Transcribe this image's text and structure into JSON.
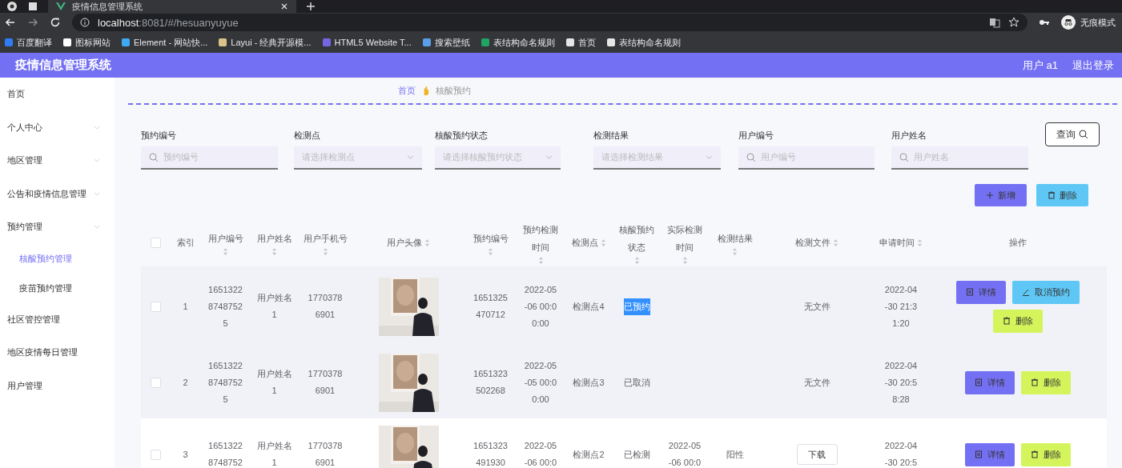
{
  "browser": {
    "tab_title": "疫情信息管理系统",
    "url_host": "localhost",
    "url_rest": ":8081/#/hesuanyuyue",
    "profile": "无痕模式",
    "bookmarks": [
      {
        "label": "百度翻译",
        "color": "#2f7cf6"
      },
      {
        "label": "图标网站",
        "color": "#ffffff"
      },
      {
        "label": "Element - 网站快...",
        "color": "#40a9f5"
      },
      {
        "label": "Layui - 经典开源模...",
        "color": "#d9c48a"
      },
      {
        "label": "HTML5 Website T...",
        "color": "#7466e0"
      },
      {
        "label": "搜索壁纸",
        "color": "#5aa0e8"
      },
      {
        "label": "表结构命名规则",
        "color": "#1fa463"
      },
      {
        "label": "首页",
        "color": "#e6e6e6"
      },
      {
        "label": "表结构命名规则",
        "color": "#e6e6e6"
      }
    ]
  },
  "header": {
    "title": "疫情信息管理系统",
    "user": "用户 a1",
    "logout": "退出登录"
  },
  "sidebar": {
    "items": [
      {
        "label": "首页",
        "expandable": false,
        "selected": false
      },
      {
        "label": "个人中心",
        "expandable": true,
        "selected": false
      },
      {
        "label": "地区管理",
        "expandable": true,
        "selected": false
      },
      {
        "label": "公告和疫情信息管理",
        "expandable": true,
        "selected": false
      },
      {
        "label": "预约管理",
        "expandable": true,
        "selected": false,
        "children": [
          {
            "label": "核酸预约管理",
            "selected": true
          },
          {
            "label": "疫苗预约管理",
            "selected": false
          }
        ]
      },
      {
        "label": "社区管控管理",
        "expandable": false,
        "selected": false
      },
      {
        "label": "地区疫情每日管理",
        "expandable": false,
        "selected": false
      },
      {
        "label": "用户管理",
        "expandable": false,
        "selected": false
      }
    ]
  },
  "breadcrumb": [
    "首页",
    "核酸预约"
  ],
  "filters": [
    {
      "label": "预约编号",
      "kind": "search",
      "placeholder": "预约编号"
    },
    {
      "label": "检测点",
      "kind": "select",
      "placeholder": "请选择检测点"
    },
    {
      "label": "核酸预约状态",
      "kind": "select",
      "placeholder": "请选择核酸预约状态"
    },
    {
      "label": "检测结果",
      "kind": "select",
      "placeholder": "请选择检测结果"
    },
    {
      "label": "用户编号",
      "kind": "search",
      "placeholder": "用户编号"
    },
    {
      "label": "用户姓名",
      "kind": "search",
      "placeholder": "用户姓名"
    }
  ],
  "query_button": "查询",
  "actions": [
    {
      "label": "新增",
      "kind": "add"
    },
    {
      "label": "删除",
      "kind": "delete"
    }
  ],
  "table": {
    "columns": [
      {
        "kind": "check",
        "checked": false
      },
      {
        "label": "索引",
        "sortable": false
      },
      {
        "label": "用户编号",
        "sortable": true
      },
      {
        "label": "用户姓名",
        "sortable": true
      },
      {
        "label": "用户手机号",
        "sortable": true
      },
      {
        "label": "用户头像",
        "sortable": true
      },
      {
        "label": "预约编号",
        "sortable": true
      },
      {
        "label": "预约检测时间",
        "sortable": true
      },
      {
        "label": "检测点",
        "sortable": true
      },
      {
        "label": "核酸预约状态",
        "sortable": true
      },
      {
        "label": "实际检测时间",
        "sortable": true
      },
      {
        "label": "检测结果",
        "sortable": true
      },
      {
        "label": "检测文件",
        "sortable": true
      },
      {
        "label": "申请时间",
        "sortable": true
      },
      {
        "label": "操作",
        "sortable": false
      }
    ],
    "rows": [
      {
        "checked": false,
        "shaded": true,
        "index": "1",
        "user_id": "165132287487525",
        "user_name": "用户姓名1",
        "phone": "17703786901",
        "booking_no": "1651325470712",
        "booking_time": "2022-05-06 00:00:00",
        "point": "检测点4",
        "status": "已预约",
        "status_highlighted": true,
        "actual_time": "",
        "result": "",
        "file": {
          "kind": "none",
          "label": "无文件"
        },
        "apply_time": "2022-04-30 21:31:20",
        "buttons": [
          {
            "kind": "detail",
            "label": "详情"
          },
          {
            "kind": "cancel",
            "label": "取消预约"
          },
          {
            "kind": "delete",
            "label": "删除"
          }
        ]
      },
      {
        "checked": false,
        "shaded": true,
        "index": "2",
        "user_id": "165132287487525",
        "user_name": "用户姓名1",
        "phone": "17703786901",
        "booking_no": "1651323502268",
        "booking_time": "2022-05-05 00:00:00",
        "point": "检测点3",
        "status": "已取消",
        "status_highlighted": false,
        "actual_time": "",
        "result": "",
        "file": {
          "kind": "none",
          "label": "无文件"
        },
        "apply_time": "2022-04-30 20:58:28",
        "buttons": [
          {
            "kind": "detail",
            "label": "详情"
          },
          {
            "kind": "delete",
            "label": "删除"
          }
        ]
      },
      {
        "checked": false,
        "shaded": false,
        "index": "3",
        "user_id": "16513228748752",
        "user_name": "用户姓名1",
        "phone": "17703786901",
        "booking_no": "1651323491930",
        "booking_time": "2022-05-06 00:0",
        "point": "检测点2",
        "status": "已检测",
        "status_highlighted": false,
        "actual_time": "2022-05-06 00:0",
        "result": "阳性",
        "file": {
          "kind": "download",
          "label": "下载"
        },
        "apply_time": "2022-04-30 20:5",
        "buttons": [
          {
            "kind": "detail",
            "label": "详情"
          },
          {
            "kind": "delete",
            "label": "删除"
          }
        ]
      }
    ]
  }
}
